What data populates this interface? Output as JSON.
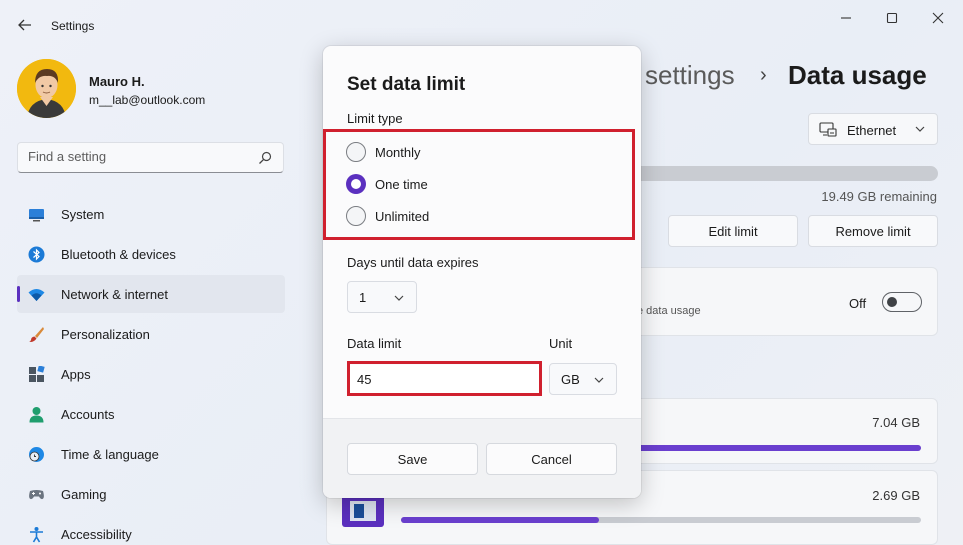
{
  "window": {
    "app_title": "Settings"
  },
  "profile": {
    "name": "Mauro H.",
    "email": "m__lab@outlook.com"
  },
  "search": {
    "placeholder": "Find a setting"
  },
  "nav": {
    "items": [
      {
        "label": "System",
        "icon": "monitor-icon"
      },
      {
        "label": "Bluetooth & devices",
        "icon": "bluetooth-icon"
      },
      {
        "label": "Network & internet",
        "icon": "wifi-icon",
        "active": true
      },
      {
        "label": "Personalization",
        "icon": "brush-icon"
      },
      {
        "label": "Apps",
        "icon": "apps-icon"
      },
      {
        "label": "Accounts",
        "icon": "person-icon"
      },
      {
        "label": "Time & language",
        "icon": "clock-globe-icon"
      },
      {
        "label": "Gaming",
        "icon": "gamepad-icon"
      },
      {
        "label": "Accessibility",
        "icon": "accessibility-icon"
      }
    ]
  },
  "main": {
    "breadcrumb_partial": "settings",
    "breadcrumb_separator": "›",
    "page_title": "Data usage",
    "network_select": "Ethernet",
    "remaining": "19.49 GB remaining",
    "edit_limit": "Edit limit",
    "remove_limit": "Remove limit",
    "background_desc_partial": "e data usage",
    "toggle_label": "Off",
    "apps": [
      {
        "size": "7.04 GB",
        "fraction": 1.0
      },
      {
        "size": "2.69 GB",
        "fraction": 0.38
      }
    ]
  },
  "dialog": {
    "title": "Set data limit",
    "limit_type_label": "Limit type",
    "options": [
      "Monthly",
      "One time",
      "Unlimited"
    ],
    "selected_option": "One time",
    "days_label": "Days until data expires",
    "days_value": "1",
    "data_limit_label": "Data limit",
    "data_limit_value": "45",
    "unit_label": "Unit",
    "unit_value": "GB",
    "save": "Save",
    "cancel": "Cancel"
  },
  "colors": {
    "accent": "#5b30bf",
    "highlight": "#d0202e",
    "bar_fill": "#6a3fcf"
  }
}
